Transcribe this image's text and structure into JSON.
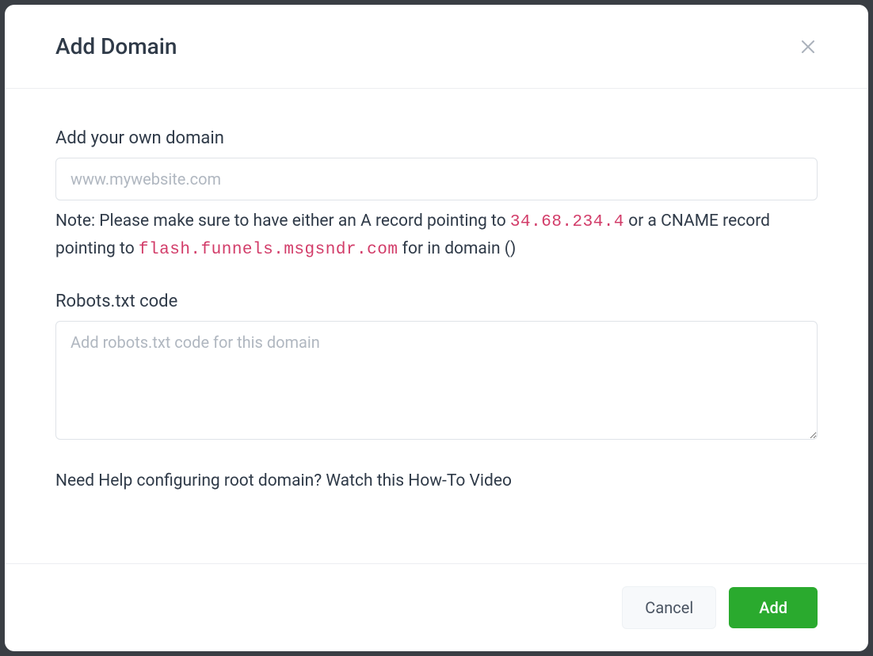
{
  "header": {
    "title": "Add Domain"
  },
  "body": {
    "domain_section": {
      "label": "Add your own domain",
      "placeholder": "www.mywebsite.com",
      "value": "",
      "note_prefix": "Note: Please make sure to have either an A record pointing to ",
      "note_ip": "34.68.234.4",
      "note_mid": " or a CNAME record pointing to ",
      "note_cname": "flash.funnels.msgsndr.com",
      "note_suffix": " for in domain ()"
    },
    "robots_section": {
      "label": "Robots.txt code",
      "placeholder": "Add robots.txt code for this domain",
      "value": ""
    },
    "help_link": "Need Help configuring root domain? Watch this How-To Video"
  },
  "footer": {
    "cancel_label": "Cancel",
    "add_label": "Add"
  }
}
